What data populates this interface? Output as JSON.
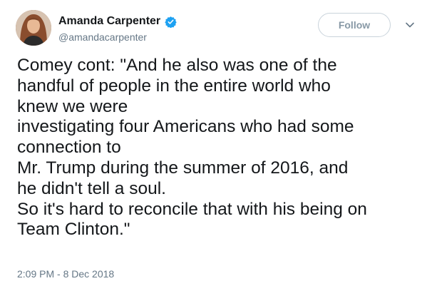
{
  "author": {
    "display_name": "Amanda Carpenter",
    "handle": "@amandacarpenter",
    "verified_icon": "verified-badge",
    "verified_color": "#1da1f2"
  },
  "actions": {
    "follow_label": "Follow",
    "menu_icon": "chevron-down"
  },
  "tweet": {
    "text": "Comey cont: \"And he also was one of the\nhandful of people in the entire world who\nknew we were\ninvestigating four Americans who had some\nconnection to\nMr. Trump during the summer of 2016, and\nhe didn't tell a soul.\nSo it's hard to reconcile that with his being on\nTeam Clinton.\"",
    "timestamp": "2:09 PM - 8 Dec 2018"
  }
}
